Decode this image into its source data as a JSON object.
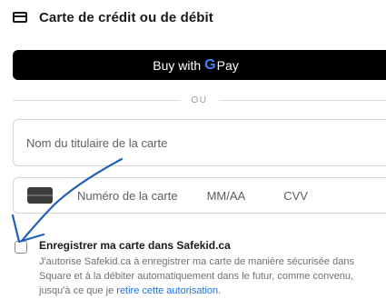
{
  "header": {
    "title": "Carte de crédit ou de débit",
    "icon": "credit-card-icon"
  },
  "gpay": {
    "label": "Buy with",
    "g": "G",
    "pay": "Pay"
  },
  "divider": {
    "label": "OU"
  },
  "name_field": {
    "placeholder": "Nom du titulaire de la carte",
    "value": ""
  },
  "card_field": {
    "number_placeholder": "Numéro de la carte",
    "expiry_placeholder": "MM/AA",
    "cvv_placeholder": "CVV"
  },
  "save": {
    "checked": false,
    "title": "Enregistrer ma carte dans Safekid.ca",
    "desc_line1": "J'autorise Safekid.ca à enregistrer ma carte de manière sécurisée dans",
    "desc_line2": "Square et à la débiter automatiquement dans le futur, comme convenu,",
    "desc_line3_prefix": "jusqu'à ce que je",
    "desc_link": "retire cette autorisation",
    "desc_line3_suffix": "."
  },
  "colors": {
    "arrow": "#1f5fb5",
    "link": "#1a73e8",
    "gpay_bg": "#000000"
  }
}
